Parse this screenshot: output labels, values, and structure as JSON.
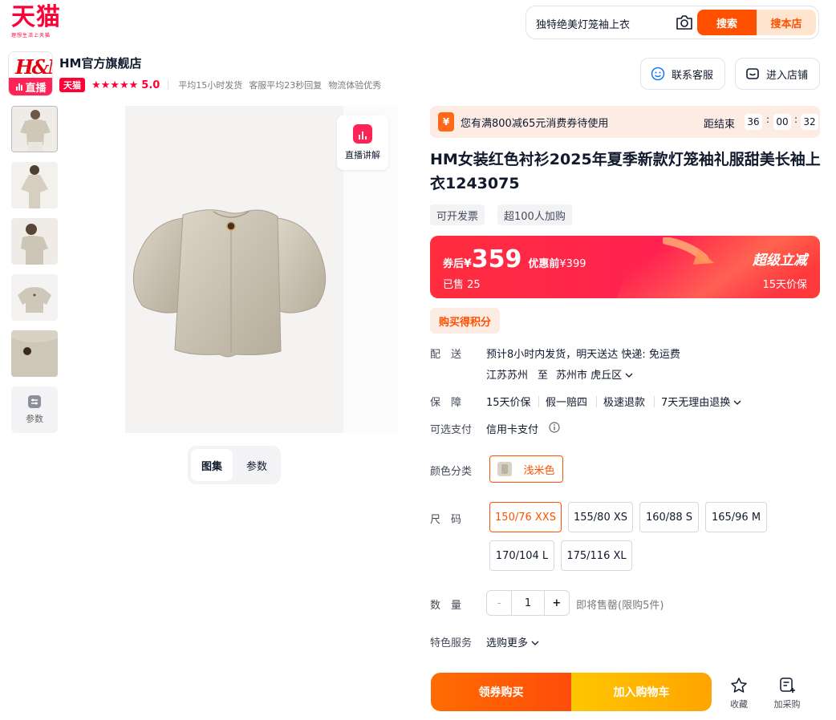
{
  "header": {
    "logo_text": "天猫",
    "logo_slogan": "理想生活上天猫",
    "search_value": "独特绝美灯笼袖上衣",
    "search_button": "搜索",
    "search_store_button": "搜本店",
    "camera_icon": "camera-icon"
  },
  "store": {
    "logo_brand": "H&M",
    "logo_live": "直播",
    "name": "HM官方旗舰店",
    "tmall_tag": "天猫",
    "stars": "★★★★★",
    "score": "5.0",
    "meta": [
      "平均15小时发货",
      "客服平均23秒回复",
      "物流体验优秀"
    ],
    "contact_label": "联系客服",
    "enter_label": "进入店铺"
  },
  "gallery": {
    "params_thumb_label": "参数",
    "live_explain_label": "直播讲解",
    "tabs": [
      "图集",
      "参数"
    ],
    "active_tab": "图集"
  },
  "coupon": {
    "icon": "¥",
    "text": "您有满800减65元消费券待使用",
    "end_label": "距结束",
    "hh": "36",
    "mm": "00",
    "ss": "32"
  },
  "product": {
    "title": "HM女装红色衬衫2025年夏季新款灯笼袖礼服甜美长袖上衣1243075",
    "tags": [
      "可开发票",
      "超100人加购"
    ]
  },
  "price": {
    "after_coupon_label": "券后",
    "yen": "¥",
    "value": "359",
    "orig_label": "优惠前",
    "orig_price": "¥399",
    "sold": "已售 25",
    "super_label": "超级立减",
    "guarantee": "15天价保"
  },
  "points_label": "购买得积分",
  "delivery": {
    "label": "配　送",
    "line1": "预计8小时内发货，明天送达  快递: 免运费",
    "from": "江苏苏州",
    "to_word": "至",
    "to": "苏州市 虎丘区"
  },
  "guarantee": {
    "label": "保　障",
    "items": [
      "15天价保",
      "假一赔四",
      "极速退款",
      "7天无理由退换"
    ]
  },
  "payment": {
    "label": "可选支付",
    "value": "信用卡支付"
  },
  "color": {
    "label": "颜色分类",
    "selected": "浅米色"
  },
  "size": {
    "label": "尺　码",
    "options": [
      "150/76 XXS",
      "155/80 XS",
      "160/88 S",
      "165/96 M",
      "170/104 L",
      "175/116 XL"
    ],
    "selected": "150/76 XXS"
  },
  "quantity": {
    "label": "数　量",
    "minus": "-",
    "value": "1",
    "plus": "+",
    "note": "即将售罄(限购5件)"
  },
  "service": {
    "label": "特色服务",
    "value": "选购更多"
  },
  "actions": {
    "buy": "领券购买",
    "cart": "加入购物车",
    "favorite": "收藏",
    "add_purchase": "加采购"
  },
  "colors": {
    "brand": "#ff0036",
    "accent": "#ff5000",
    "price_red": "#ff2251",
    "cart_yellow": "#ffc600"
  }
}
